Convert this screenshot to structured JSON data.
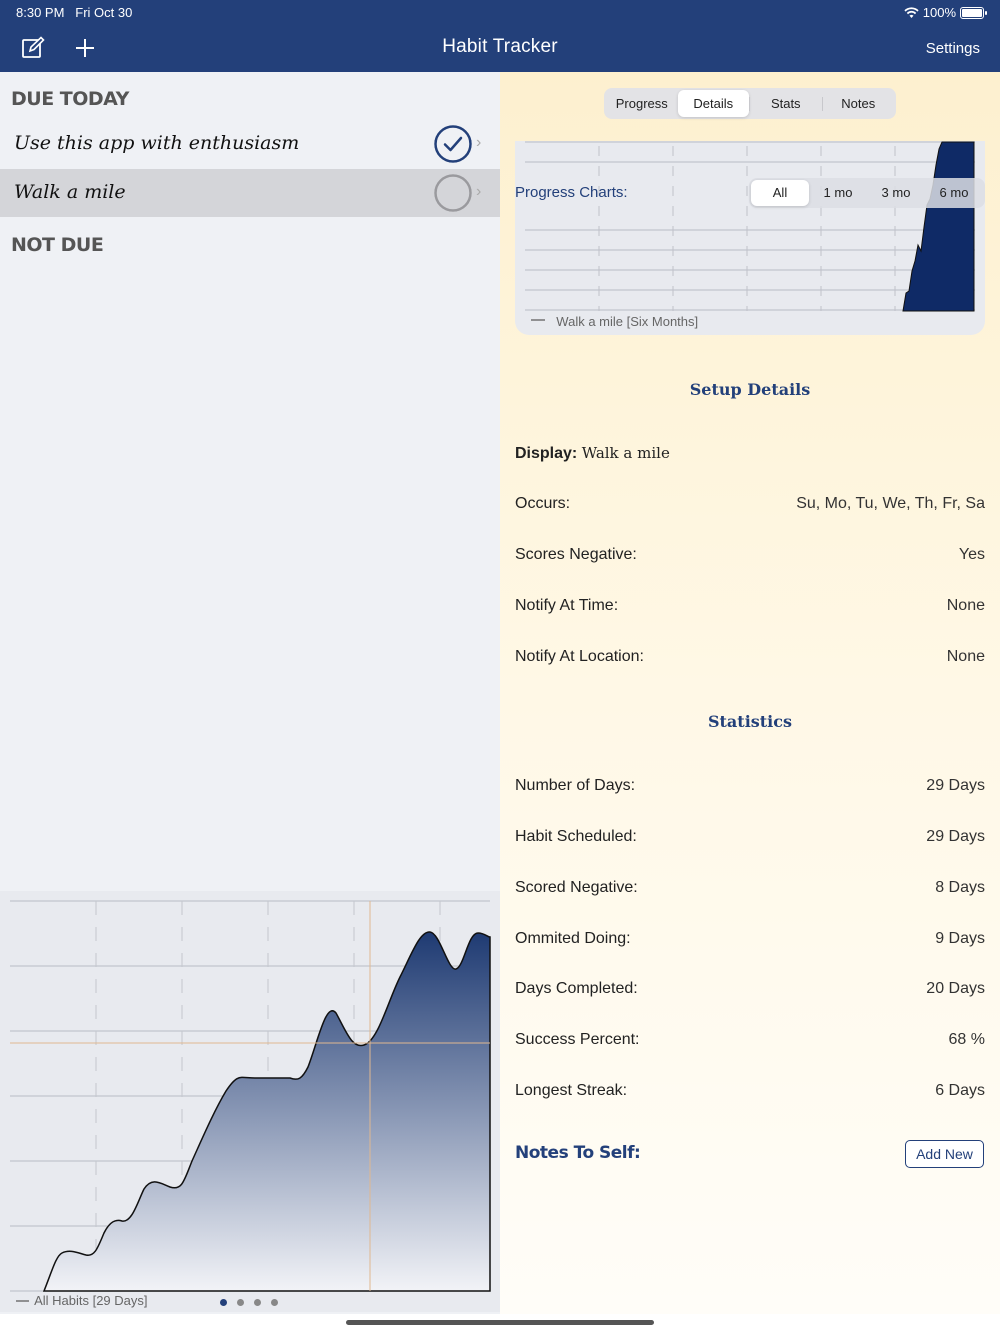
{
  "status": {
    "time": "8:30 PM",
    "date": "Fri Oct 30",
    "battery": "100%"
  },
  "nav": {
    "title": "Habit Tracker",
    "settings": "Settings",
    "compose_icon": "compose-icon",
    "add_icon": "plus-icon"
  },
  "left": {
    "due_header": "DUE TODAY",
    "not_due_header": "NOT DUE",
    "habits": [
      {
        "name": "Use this app with enthusiasm",
        "done": true
      },
      {
        "name": "Walk a mile",
        "done": false
      }
    ],
    "chart_legend": "All Habits [29 Days]",
    "page_dots": 4,
    "page_index": 0
  },
  "right": {
    "tabs": [
      "Progress",
      "Details",
      "Stats",
      "Notes"
    ],
    "active_tab": "Details",
    "progress_label": "Progress Charts:",
    "ranges": [
      "All",
      "1 mo",
      "3 mo",
      "6 mo"
    ],
    "active_range": "All",
    "chart_legend": "Walk a mile [Six Months]",
    "setup_title": "Setup Details",
    "display_label": "Display:",
    "display_value": "Walk a mile",
    "setup_rows": [
      {
        "label": "Occurs:",
        "value": "Su, Mo, Tu, We, Th, Fr, Sa"
      },
      {
        "label": "Scores Negative:",
        "value": "Yes"
      },
      {
        "label": "Notify At Time:",
        "value": "None"
      },
      {
        "label": "Notify At Location:",
        "value": "None"
      }
    ],
    "stats_title": "Statistics",
    "stats_rows": [
      {
        "label": "Number of Days:",
        "value": "29 Days"
      },
      {
        "label": "Habit Scheduled:",
        "value": "29 Days"
      },
      {
        "label": "Scored Negative:",
        "value": "8 Days"
      },
      {
        "label": "Ommited Doing:",
        "value": "9 Days"
      },
      {
        "label": "Days Completed:",
        "value": "20 Days"
      },
      {
        "label": "Success Percent:",
        "value": "68 %"
      },
      {
        "label": "Longest Streak:",
        "value": "6 Days"
      }
    ],
    "notes_label": "Notes To Self:",
    "add_new": "Add New"
  },
  "colors": {
    "nav_bg": "#23407a",
    "accent": "#23407a",
    "chart_fill_dark": "#0f2a66"
  }
}
